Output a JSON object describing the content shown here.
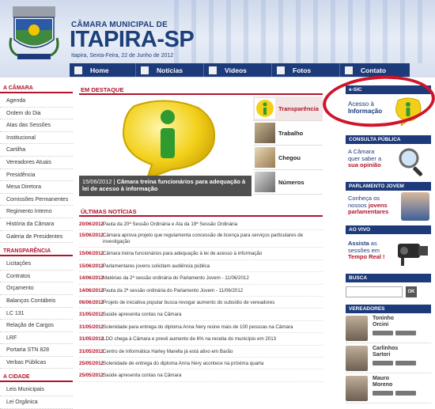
{
  "header": {
    "subtitle": "CÂMARA MUNICIPAL DE",
    "title": "ITAPIRA-SP",
    "date": "Itapira, Sexta-Feira, 22 de Junho de 2012"
  },
  "nav": [
    "Home",
    "Notícias",
    "Vídeos",
    "Fotos",
    "Contato"
  ],
  "sidebar": {
    "camara_title": "A CÂMARA",
    "camara_items": [
      "Agenda",
      "Ordem do Dia",
      "Atas das Sessões",
      "Institucional",
      "Cartilha",
      "Vereadores Atuais",
      "Presidência",
      "Mesa Diretora",
      "Comissões Permanentes",
      "Regimento Interno",
      "História da Câmara",
      "Galeria de Presidentes"
    ],
    "transparencia_title": "TRANSPARÊNCIA",
    "transparencia_items": [
      "Licitações",
      "Contratos",
      "Orçamento",
      "Balanços Contábeis",
      "LC 131",
      "Relação de Cargos",
      "LRF",
      "Portaria STN 828",
      "Verbas Públicas"
    ],
    "cidade_title": "A CIDADE",
    "cidade_items": [
      "Leis Municipais",
      "Lei Orgânica"
    ]
  },
  "destaque": {
    "title": "EM DESTAQUE",
    "caption_date": "15/06/2012",
    "caption_text": "Câmara treina funcionários para adequação à lei de acesso à informação",
    "tabs": [
      "Transparência",
      "Trabalho",
      "Chegou",
      "Números"
    ]
  },
  "news": {
    "title": "ÚLTIMAS NOTÍCIAS",
    "items": [
      {
        "date": "20/06/2012",
        "text": "Pauta da 20ª Sessão Ordinária e Ata da 19ª Sessão Ordinária"
      },
      {
        "date": "15/06/2012",
        "text": "Câmara aprova projeto que regulamenta concessão de licença para serviços particulares de investigação"
      },
      {
        "date": "15/06/2012",
        "text": "Câmara treina funcionários para adequação à lei de acesso à informação"
      },
      {
        "date": "15/06/2012",
        "text": "Parlamentares jovens solicitam audiência pública"
      },
      {
        "date": "14/06/2012",
        "text": "Matérias da 2ª sessão ordinária do Parlamento Jovem - 11/06/2012"
      },
      {
        "date": "14/06/2012",
        "text": "Pauta da 2ª sessão ordinária do Parlamento Jovem - 11/06/2012"
      },
      {
        "date": "06/06/2012",
        "text": "Projeto de iniciativa popular busca revogar aumento do subsídio de vereadores"
      },
      {
        "date": "31/05/2012",
        "text": "Saúde apresenta contas na Câmara"
      },
      {
        "date": "31/05/2012",
        "text": "Solenidade para entrega do diploma Anna Nery reúne mais de 100 pessoas na Câmara"
      },
      {
        "date": "31/05/2012",
        "text": "LDO chega à Câmara e prevê aumento de 6% na receita do município em 2013"
      },
      {
        "date": "31/05/2012",
        "text": "Centro de Informática Harley Marella já está ativo em Barão"
      },
      {
        "date": "25/05/2012",
        "text": "Solenidade de entrega do diploma Anna Nery acontece na próxima quarta"
      },
      {
        "date": "25/05/2012",
        "text": "Saúde apresenta contas na Câmara"
      }
    ]
  },
  "right": {
    "esic_head": "e-SIC",
    "esic_line1": "Acesso à",
    "esic_line2": "Informação",
    "consulta_head": "CONSULTA PÚBLICA",
    "consulta_line1": "A Câmara",
    "consulta_line2": "quer saber a",
    "consulta_line3": "sua opinião",
    "pj_head": "PARLAMENTO JOVEM",
    "pj_line1": "Conheça os",
    "pj_line2a": "nossos ",
    "pj_line2b": "jovens",
    "pj_line3": "parlamentares",
    "vivo_head": "AO VIVO",
    "vivo_line1": "Assista",
    "vivo_line1b": " as",
    "vivo_line2": "sessões em",
    "vivo_line3": "Tempo Real !",
    "busca_head": "BUSCA",
    "busca_ok": "OK",
    "vereadores_head": "VEREADORES",
    "vereadores": [
      "Toninho Orcini",
      "Carlinhos Sartori",
      "Mauro Moreno"
    ]
  },
  "colors": {
    "accent": "#b1142a",
    "navy": "#1d3a7a",
    "highlight_circle": "#d0142a"
  }
}
